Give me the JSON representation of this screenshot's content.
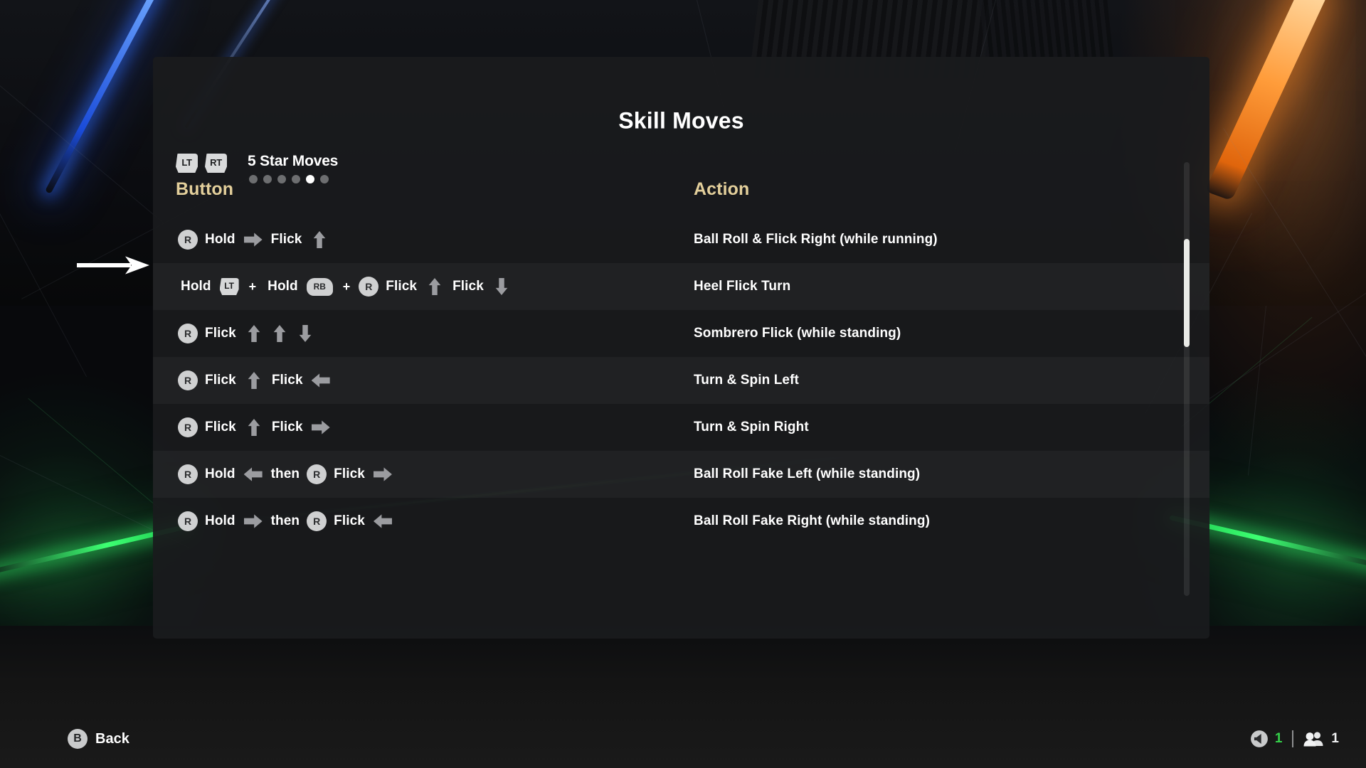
{
  "panel": {
    "title": "Skill Moves",
    "pager": {
      "prev_button": "LT",
      "next_button": "RT",
      "label": "5 Star Moves",
      "total_pages": 6,
      "active_page": 5
    },
    "columns": {
      "button": "Button",
      "action": "Action"
    },
    "rows": [
      {
        "tokens": [
          {
            "kind": "stick",
            "value": "R"
          },
          {
            "kind": "text",
            "value": "Hold"
          },
          {
            "kind": "arrow",
            "value": "right"
          },
          {
            "kind": "text",
            "value": "Flick"
          },
          {
            "kind": "arrow",
            "value": "up"
          }
        ],
        "action": "Ball Roll & Flick Right (while running)"
      },
      {
        "tokens": [
          {
            "kind": "text",
            "value": "Hold"
          },
          {
            "kind": "trigger",
            "value": "LT"
          },
          {
            "kind": "plus",
            "value": "+"
          },
          {
            "kind": "text",
            "value": "Hold"
          },
          {
            "kind": "bumper",
            "value": "RB"
          },
          {
            "kind": "plus",
            "value": "+"
          },
          {
            "kind": "stick",
            "value": "R"
          },
          {
            "kind": "text",
            "value": "Flick"
          },
          {
            "kind": "arrow",
            "value": "up"
          },
          {
            "kind": "text",
            "value": "Flick"
          },
          {
            "kind": "arrow",
            "value": "down"
          }
        ],
        "action": "Heel Flick Turn"
      },
      {
        "tokens": [
          {
            "kind": "stick",
            "value": "R"
          },
          {
            "kind": "text",
            "value": "Flick"
          },
          {
            "kind": "arrow",
            "value": "up"
          },
          {
            "kind": "arrow",
            "value": "up"
          },
          {
            "kind": "arrow",
            "value": "down"
          }
        ],
        "action": "Sombrero Flick (while standing)"
      },
      {
        "tokens": [
          {
            "kind": "stick",
            "value": "R"
          },
          {
            "kind": "text",
            "value": "Flick"
          },
          {
            "kind": "arrow",
            "value": "up"
          },
          {
            "kind": "text",
            "value": "Flick"
          },
          {
            "kind": "arrow",
            "value": "left"
          }
        ],
        "action": "Turn & Spin Left"
      },
      {
        "tokens": [
          {
            "kind": "stick",
            "value": "R"
          },
          {
            "kind": "text",
            "value": "Flick"
          },
          {
            "kind": "arrow",
            "value": "up"
          },
          {
            "kind": "text",
            "value": "Flick"
          },
          {
            "kind": "arrow",
            "value": "right"
          }
        ],
        "action": "Turn & Spin Right"
      },
      {
        "tokens": [
          {
            "kind": "stick",
            "value": "R"
          },
          {
            "kind": "text",
            "value": "Hold"
          },
          {
            "kind": "arrow",
            "value": "left"
          },
          {
            "kind": "text",
            "value": "then"
          },
          {
            "kind": "stick",
            "value": "R"
          },
          {
            "kind": "text",
            "value": "Flick"
          },
          {
            "kind": "arrow",
            "value": "right"
          }
        ],
        "action": "Ball Roll Fake Left (while standing)"
      },
      {
        "tokens": [
          {
            "kind": "stick",
            "value": "R"
          },
          {
            "kind": "text",
            "value": "Hold"
          },
          {
            "kind": "arrow",
            "value": "right"
          },
          {
            "kind": "text",
            "value": "then"
          },
          {
            "kind": "stick",
            "value": "R"
          },
          {
            "kind": "text",
            "value": "Flick"
          },
          {
            "kind": "arrow",
            "value": "left"
          }
        ],
        "action": "Ball Roll Fake Right (while standing)"
      }
    ]
  },
  "footer": {
    "back_button": "B",
    "back_label": "Back",
    "volume_icon": "volume-icon",
    "volume_value": "1",
    "players_icon": "players-icon",
    "players_value": "1"
  },
  "annotation": {
    "arrow_icon": "pointer-arrow-icon",
    "points_at_row": 2
  },
  "colors": {
    "accent_gold": "#e3cf9b",
    "volume_green": "#35d14a",
    "panel_bg": "#1a1b1d"
  }
}
